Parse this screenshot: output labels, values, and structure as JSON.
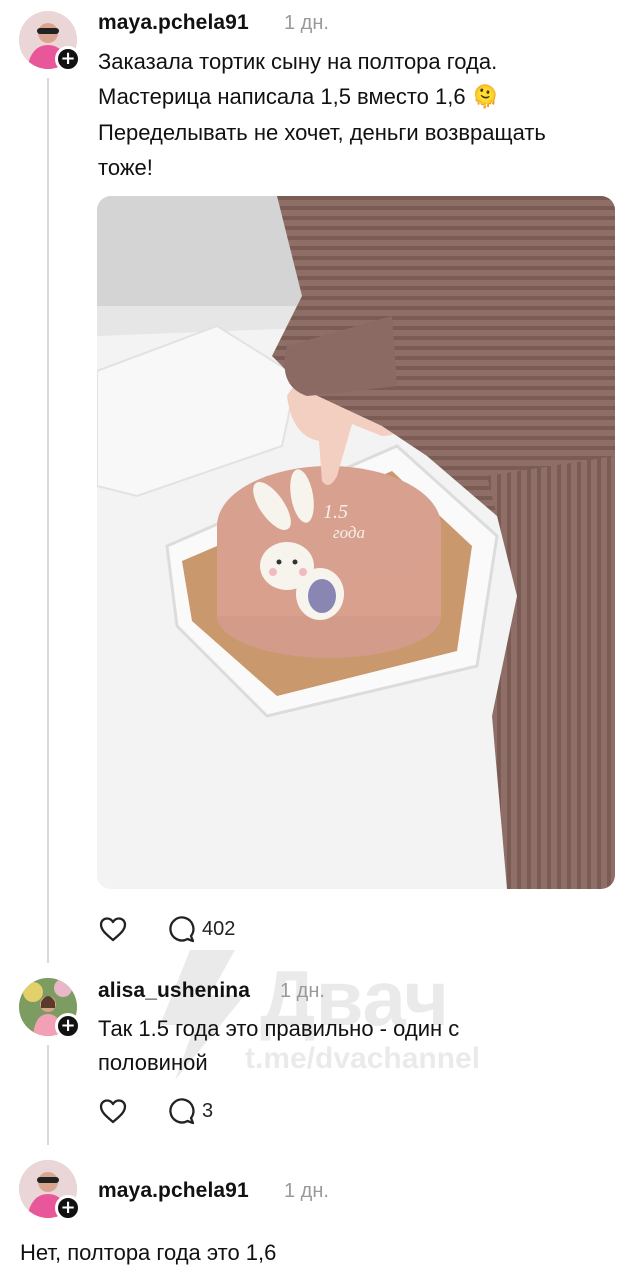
{
  "posts": [
    {
      "username": "maya.pchela91",
      "time": "1 дн.",
      "text_lines": [
        "Заказала тортик сыну на полтора года.",
        "Мастерица написала 1,5 вместо 1,6 🫠",
        "Переделывать не хочет, деньги возвращать",
        "тоже!"
      ],
      "image": {
        "cake_text_line1": "1.5",
        "cake_text_line2": "года"
      },
      "actions": {
        "like_icon": "heart-icon",
        "comment_icon": "comment-icon",
        "comment_count": "402"
      }
    },
    {
      "username": "alisa_ushenina",
      "time": "1 дн.",
      "text_lines": [
        "Так 1.5 года это правильно - один с",
        "половиной"
      ],
      "actions": {
        "like_icon": "heart-icon",
        "comment_icon": "comment-icon",
        "comment_count": "3"
      }
    },
    {
      "username": "maya.pchela91",
      "time": "1 дн.",
      "text_lines": [
        "Нет, полтора года это 1,6"
      ]
    }
  ],
  "watermark": {
    "brand": "Двач",
    "link": "t.me/dvachannel"
  },
  "colors": {
    "text": "#111111",
    "muted": "#9a9a9a",
    "thread_line": "#d9d9d9"
  }
}
